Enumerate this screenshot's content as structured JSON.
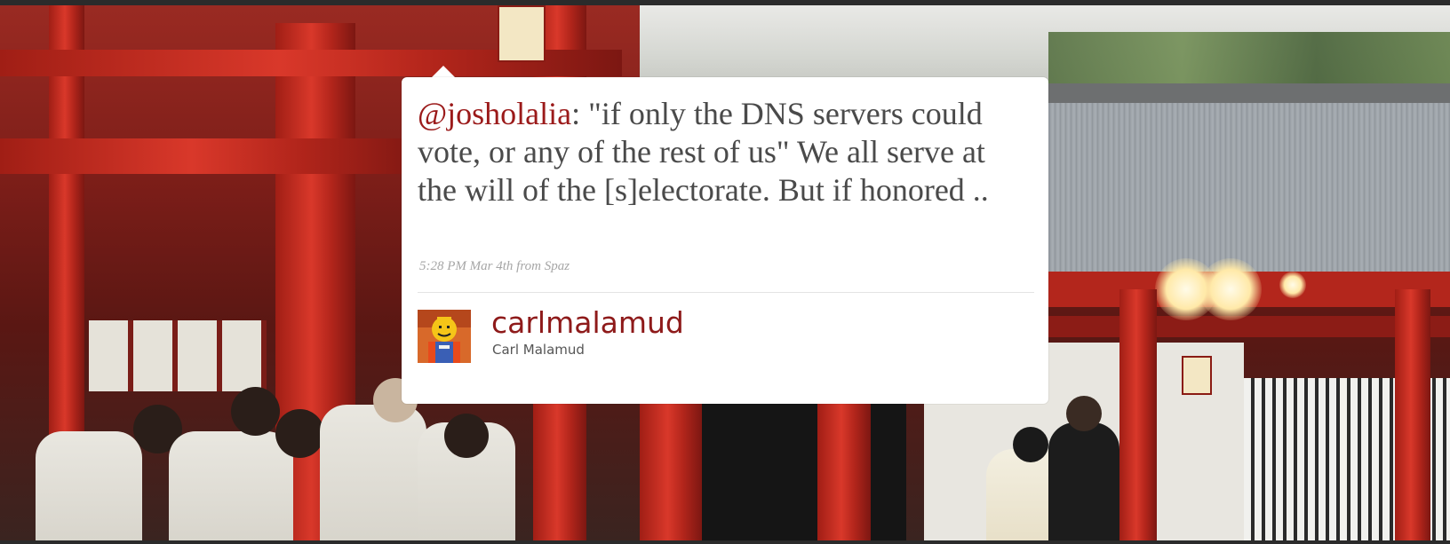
{
  "tweet": {
    "mention": "@josholalia",
    "text_after_mention": ": \"if only the DNS servers could vote, or any of the rest of us\" We all serve at the will of the [s]electorate. But if honored ..",
    "time": "5:28 PM Mar 4th",
    "source_prefix": "from",
    "source": "Spaz"
  },
  "author": {
    "username": "carlmalamud",
    "full_name": "Carl Malamud",
    "avatar_icon": "lego-figure-avatar"
  },
  "colors": {
    "accent": "#9b1a1a",
    "text": "#4a4a4a",
    "meta": "#a6a6a6",
    "card_bg": "#ffffff"
  }
}
